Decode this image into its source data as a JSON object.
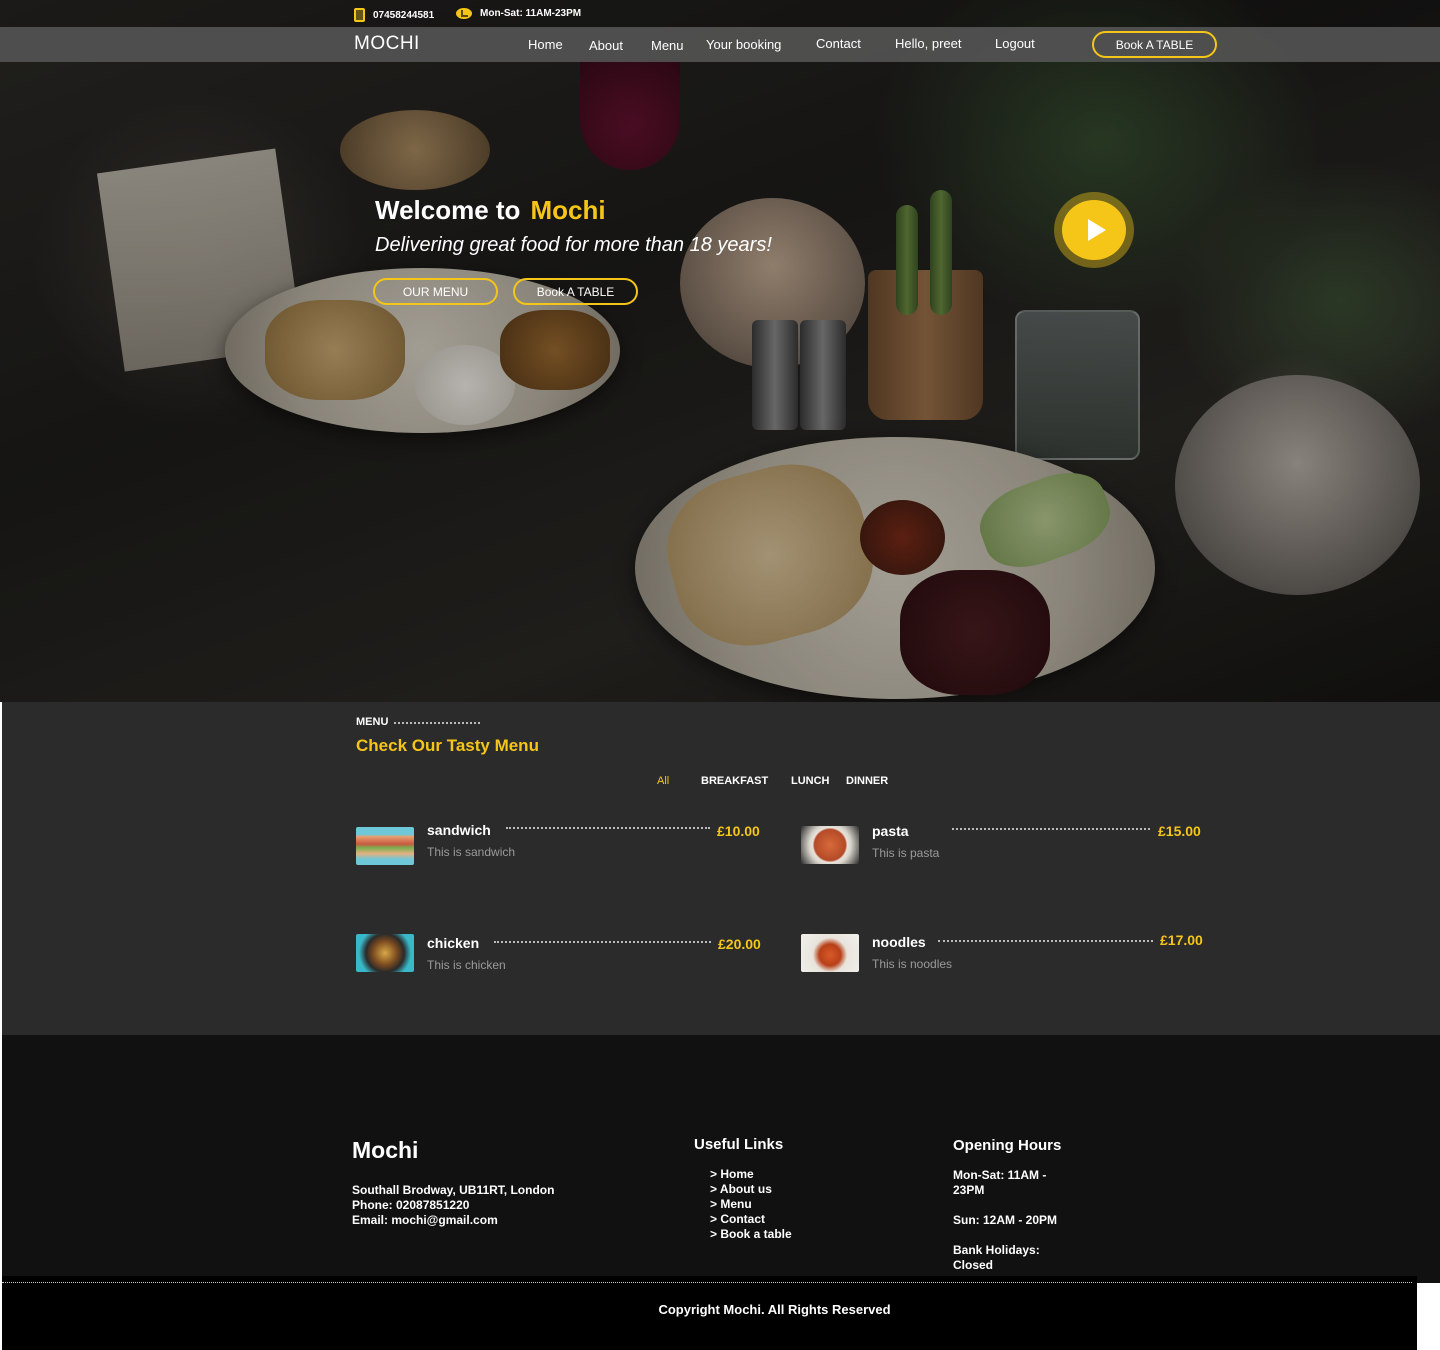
{
  "topbar": {
    "phone": "07458244581",
    "hours": "Mon-Sat: 11AM-23PM",
    "phone_icon": "phone-icon",
    "hours_icon": "clock-icon"
  },
  "nav": {
    "logo": "MOCHI",
    "links": [
      "Home",
      "About",
      "Menu",
      "Your booking",
      "Contact",
      "Hello, preet",
      "Logout"
    ],
    "cta": "Book A TABLE"
  },
  "hero": {
    "welcome_prefix": "Welcome to",
    "brand": "Mochi",
    "tagline": "Delivering great food for more than 18 years!",
    "btn_menu": "OUR MENU",
    "btn_book": "Book A TABLE",
    "play_icon": "play-icon"
  },
  "menu": {
    "label": "MENU",
    "heading": "Check Our Tasty Menu",
    "filters": [
      "All",
      "BREAKFAST",
      "LUNCH",
      "DINNER"
    ],
    "active_filter": "All",
    "items": [
      {
        "name": "sandwich",
        "desc": "This is sandwich",
        "price": "£10.00"
      },
      {
        "name": "pasta",
        "desc": "This is pasta",
        "price": "£15.00"
      },
      {
        "name": "chicken",
        "desc": "This is chicken",
        "price": "£20.00"
      },
      {
        "name": "noodles",
        "desc": "This is noodles",
        "price": "£17.00"
      }
    ]
  },
  "footer": {
    "brand": "Mochi",
    "address": "Southall Brodway, UB11RT, London",
    "phone": "Phone: 02087851220",
    "email": "Email: mochi@gmail.com",
    "links_heading": "Useful Links",
    "links": [
      "> Home",
      "> About us",
      "> Menu",
      "> Contact",
      "> Book a table"
    ],
    "hours_heading": "Opening Hours",
    "hours": [
      "Mon-Sat: 11AM - 23PM",
      "Sun: 12AM - 20PM",
      "Bank Holidays: Closed"
    ],
    "copyright": "Copyright Mochi. All Rights Reserved"
  },
  "colors": {
    "accent": "#f5c518",
    "nav_bg": "#555555",
    "menu_bg": "#2b2b2b",
    "footer_bg": "#111111"
  }
}
